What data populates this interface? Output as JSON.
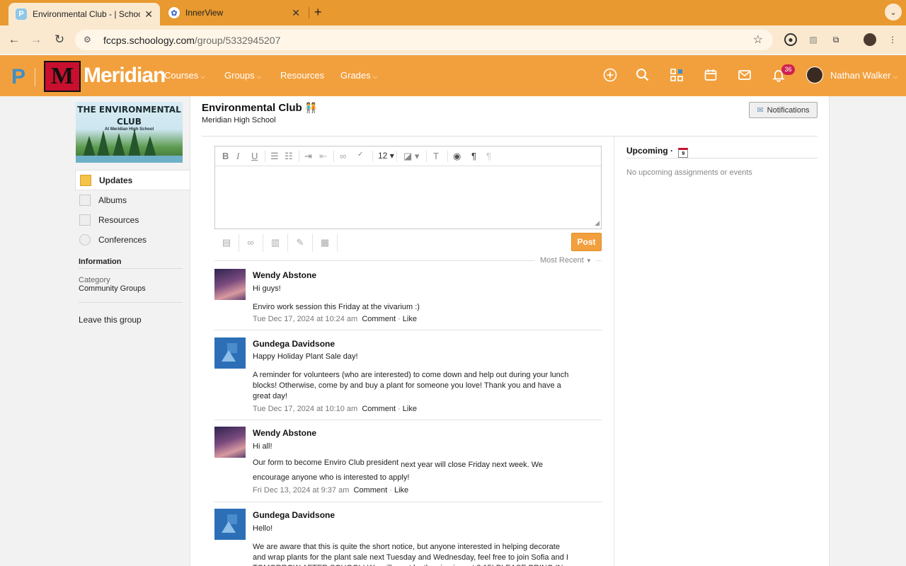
{
  "browser": {
    "tabs": [
      {
        "title": "Environmental Club - | Schoo",
        "icon": "schoology-icon"
      },
      {
        "title": "InnerView",
        "icon": "innerview-icon"
      }
    ],
    "url_host": "fccps.schoology.com",
    "url_path": "/group/5332945207"
  },
  "header": {
    "school_name": "Meridian",
    "logo_letter": "M",
    "nav": [
      "Courses",
      "Groups",
      "Resources",
      "Grades"
    ],
    "notification_count": "36",
    "user_name": "Nathan Walker"
  },
  "group": {
    "banner_title": "THE ENVIRONMENTAL CLUB",
    "banner_subtitle": "At Meridian High School",
    "title": "Environmental Club",
    "emoji": "🧑‍🤝‍🧑",
    "school": "Meridian High School",
    "notifications_label": "Notifications"
  },
  "sidebar": {
    "items": [
      {
        "label": "Updates"
      },
      {
        "label": "Albums"
      },
      {
        "label": "Resources"
      },
      {
        "label": "Conferences"
      }
    ],
    "info_heading": "Information",
    "category_label": "Category",
    "category_value": "Community Groups",
    "leave_label": "Leave this group"
  },
  "editor": {
    "font_size": "12",
    "post_label": "Post",
    "sort_label": "Most Recent"
  },
  "posts": [
    {
      "author": "Wendy Abstone",
      "lines": [
        "Hi guys!",
        "Enviro work session this Friday at the vivarium :)"
      ],
      "date": "Tue Dec 17, 2024 at 10:24 am",
      "comment": "Comment",
      "like": "Like"
    },
    {
      "author": "Gundega Davidsone",
      "lines": [
        "Happy Holiday Plant Sale day!",
        "A reminder for volunteers (who are interested) to come down and help out during your lunch blocks! Otherwise, come by and buy a plant for someone you love! Thank you and have a great day!"
      ],
      "date": "Tue Dec 17, 2024 at 10:10 am",
      "comment": "Comment",
      "like": "Like"
    },
    {
      "author": "Wendy Abstone",
      "lines": [
        "Hi all!",
        "Our form to become Enviro Club president",
        "next year will close Friday next week. We encourage anyone who is interested to apply!"
      ],
      "date": "Fri Dec 13, 2024 at 9:37 am",
      "comment": "Comment",
      "like": "Like"
    },
    {
      "author": "Gundega Davidsone",
      "lines": [
        "Hello!",
        "We are aware that this is quite the short notice, but anyone interested in helping decorate and wrap plants for the plant sale next Tuesday and Wednesday, feel free to join Sofia and I TOMORROW AFTER SCHOOL! We will meet by the vivarium at 3:15! PLEASE BRING IN"
      ]
    }
  ],
  "upcoming": {
    "title": "Upcoming",
    "calendar_day": "9",
    "empty": "No upcoming assignments or events"
  },
  "colors": {
    "tabbar": "#e8992f",
    "brand_orange": "#f2a03d",
    "badge_red": "#d0224e"
  }
}
